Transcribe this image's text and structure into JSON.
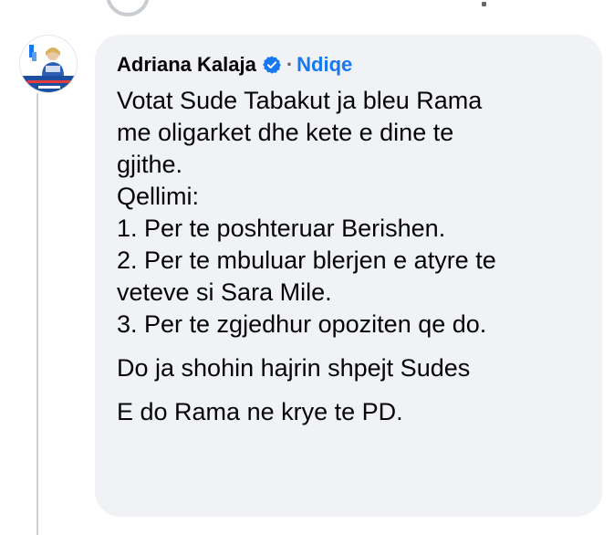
{
  "comment": {
    "author": "Adriana Kalaja",
    "verified": true,
    "separator": "·",
    "follow_label": "Ndiqe",
    "lines": [
      "Votat Sude Tabakut ja bleu Rama",
      "me oligarket dhe kete e dine te",
      "gjithe.",
      "Qellimi:",
      "1. Per te poshteruar Berishen.",
      "2. Per te mbuluar blerjen e atyre te",
      "veteve si Sara Mile.",
      "3. Per te zgjedhur opoziten qe do."
    ],
    "line_9": "Do ja shohin hajrin shpejt Sudes",
    "line_10": "E do Rama ne krye te PD."
  },
  "colors": {
    "bubble_bg": "#f0f2f5",
    "link_blue": "#1877f2",
    "verified_blue": "#1877f2",
    "text": "#050505",
    "secondary": "#65676b"
  },
  "icons": {
    "verified": "verified-badge-icon",
    "avatar": "profile-avatar"
  }
}
